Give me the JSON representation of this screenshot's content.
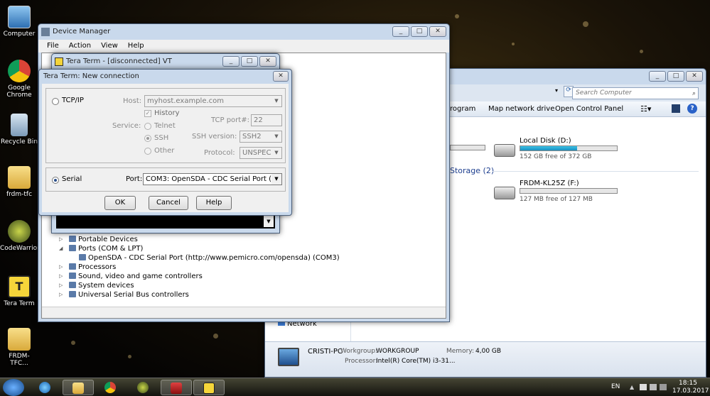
{
  "desktop": {
    "icons": [
      {
        "label": "Computer"
      },
      {
        "label": "Google Chrome"
      },
      {
        "label": "Recycle Bin"
      },
      {
        "label": "frdm-tfc"
      },
      {
        "label": "CodeWarrior"
      },
      {
        "label": "Tera Term"
      },
      {
        "label": "FRDM-TFC..."
      }
    ]
  },
  "explorer": {
    "search_placeholder": "Search Computer",
    "commands": {
      "program": "rogram",
      "map_drive": "Map network drive",
      "control_panel": "Open Control Panel"
    },
    "drives": [
      {
        "name": "Local Disk (D:)",
        "free": "152 GB free of 372 GB",
        "used_fraction": 0.59
      },
      {
        "name": "FRDM-KL25Z (F:)",
        "free": "127 MB free of 127 MB",
        "used_fraction": 0.0
      }
    ],
    "storage_group": "Storage (2)",
    "nav_network": "Network",
    "details": {
      "pc_name": "CRISTI-PC",
      "workgroup_label": "Workgroup:",
      "workgroup_value": "WORKGROUP",
      "memory_label": "Memory:",
      "memory_value": "4,00 GB",
      "processor_label": "Processor:",
      "processor_value": "Intel(R) Core(TM) i3-31..."
    }
  },
  "device_manager": {
    "title": "Device Manager",
    "menu": [
      "File",
      "Action",
      "View",
      "Help"
    ],
    "tree": [
      {
        "label": "Portable Devices",
        "expanded": false
      },
      {
        "label": "Ports (COM & LPT)",
        "expanded": true
      },
      {
        "label": "OpenSDA - CDC Serial Port (http://www.pemicro.com/opensda) (COM3)",
        "child": true
      },
      {
        "label": "Processors",
        "expanded": false
      },
      {
        "label": "Sound, video and game controllers",
        "expanded": false
      },
      {
        "label": "System devices",
        "expanded": false
      },
      {
        "label": "Universal Serial Bus controllers",
        "expanded": false
      }
    ]
  },
  "teraterm_vt": {
    "title": "Tera Term - [disconnected] VT"
  },
  "new_connection": {
    "title": "Tera Term: New connection",
    "tcpip_label": "TCP/IP",
    "host_label": "Host:",
    "host_value": "myhost.example.com",
    "history_label": "History",
    "service_label": "Service:",
    "telnet_label": "Telnet",
    "ssh_label": "SSH",
    "other_label": "Other",
    "tcp_port_label": "TCP port#:",
    "tcp_port_value": "22",
    "ssh_version_label": "SSH version:",
    "ssh_version_value": "SSH2",
    "protocol_label": "Protocol:",
    "protocol_value": "UNSPEC",
    "serial_label": "Serial",
    "port_label": "Port:",
    "port_value": "COM3: OpenSDA - CDC Serial Port (htt",
    "ok": "OK",
    "cancel": "Cancel",
    "help": "Help"
  },
  "taskbar": {
    "language": "EN",
    "time": "18:15",
    "date": "17.03.2017"
  }
}
